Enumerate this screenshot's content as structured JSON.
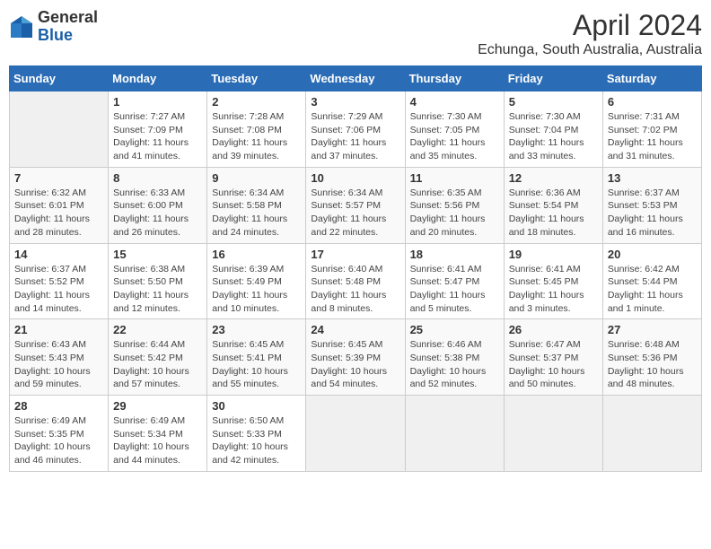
{
  "header": {
    "logo_general": "General",
    "logo_blue": "Blue",
    "title": "April 2024",
    "subtitle": "Echunga, South Australia, Australia"
  },
  "calendar": {
    "days_of_week": [
      "Sunday",
      "Monday",
      "Tuesday",
      "Wednesday",
      "Thursday",
      "Friday",
      "Saturday"
    ],
    "weeks": [
      [
        {
          "day": "",
          "info": ""
        },
        {
          "day": "1",
          "info": "Sunrise: 7:27 AM\nSunset: 7:09 PM\nDaylight: 11 hours\nand 41 minutes."
        },
        {
          "day": "2",
          "info": "Sunrise: 7:28 AM\nSunset: 7:08 PM\nDaylight: 11 hours\nand 39 minutes."
        },
        {
          "day": "3",
          "info": "Sunrise: 7:29 AM\nSunset: 7:06 PM\nDaylight: 11 hours\nand 37 minutes."
        },
        {
          "day": "4",
          "info": "Sunrise: 7:30 AM\nSunset: 7:05 PM\nDaylight: 11 hours\nand 35 minutes."
        },
        {
          "day": "5",
          "info": "Sunrise: 7:30 AM\nSunset: 7:04 PM\nDaylight: 11 hours\nand 33 minutes."
        },
        {
          "day": "6",
          "info": "Sunrise: 7:31 AM\nSunset: 7:02 PM\nDaylight: 11 hours\nand 31 minutes."
        }
      ],
      [
        {
          "day": "7",
          "info": "Sunrise: 6:32 AM\nSunset: 6:01 PM\nDaylight: 11 hours\nand 28 minutes."
        },
        {
          "day": "8",
          "info": "Sunrise: 6:33 AM\nSunset: 6:00 PM\nDaylight: 11 hours\nand 26 minutes."
        },
        {
          "day": "9",
          "info": "Sunrise: 6:34 AM\nSunset: 5:58 PM\nDaylight: 11 hours\nand 24 minutes."
        },
        {
          "day": "10",
          "info": "Sunrise: 6:34 AM\nSunset: 5:57 PM\nDaylight: 11 hours\nand 22 minutes."
        },
        {
          "day": "11",
          "info": "Sunrise: 6:35 AM\nSunset: 5:56 PM\nDaylight: 11 hours\nand 20 minutes."
        },
        {
          "day": "12",
          "info": "Sunrise: 6:36 AM\nSunset: 5:54 PM\nDaylight: 11 hours\nand 18 minutes."
        },
        {
          "day": "13",
          "info": "Sunrise: 6:37 AM\nSunset: 5:53 PM\nDaylight: 11 hours\nand 16 minutes."
        }
      ],
      [
        {
          "day": "14",
          "info": "Sunrise: 6:37 AM\nSunset: 5:52 PM\nDaylight: 11 hours\nand 14 minutes."
        },
        {
          "day": "15",
          "info": "Sunrise: 6:38 AM\nSunset: 5:50 PM\nDaylight: 11 hours\nand 12 minutes."
        },
        {
          "day": "16",
          "info": "Sunrise: 6:39 AM\nSunset: 5:49 PM\nDaylight: 11 hours\nand 10 minutes."
        },
        {
          "day": "17",
          "info": "Sunrise: 6:40 AM\nSunset: 5:48 PM\nDaylight: 11 hours\nand 8 minutes."
        },
        {
          "day": "18",
          "info": "Sunrise: 6:41 AM\nSunset: 5:47 PM\nDaylight: 11 hours\nand 5 minutes."
        },
        {
          "day": "19",
          "info": "Sunrise: 6:41 AM\nSunset: 5:45 PM\nDaylight: 11 hours\nand 3 minutes."
        },
        {
          "day": "20",
          "info": "Sunrise: 6:42 AM\nSunset: 5:44 PM\nDaylight: 11 hours\nand 1 minute."
        }
      ],
      [
        {
          "day": "21",
          "info": "Sunrise: 6:43 AM\nSunset: 5:43 PM\nDaylight: 10 hours\nand 59 minutes."
        },
        {
          "day": "22",
          "info": "Sunrise: 6:44 AM\nSunset: 5:42 PM\nDaylight: 10 hours\nand 57 minutes."
        },
        {
          "day": "23",
          "info": "Sunrise: 6:45 AM\nSunset: 5:41 PM\nDaylight: 10 hours\nand 55 minutes."
        },
        {
          "day": "24",
          "info": "Sunrise: 6:45 AM\nSunset: 5:39 PM\nDaylight: 10 hours\nand 54 minutes."
        },
        {
          "day": "25",
          "info": "Sunrise: 6:46 AM\nSunset: 5:38 PM\nDaylight: 10 hours\nand 52 minutes."
        },
        {
          "day": "26",
          "info": "Sunrise: 6:47 AM\nSunset: 5:37 PM\nDaylight: 10 hours\nand 50 minutes."
        },
        {
          "day": "27",
          "info": "Sunrise: 6:48 AM\nSunset: 5:36 PM\nDaylight: 10 hours\nand 48 minutes."
        }
      ],
      [
        {
          "day": "28",
          "info": "Sunrise: 6:49 AM\nSunset: 5:35 PM\nDaylight: 10 hours\nand 46 minutes."
        },
        {
          "day": "29",
          "info": "Sunrise: 6:49 AM\nSunset: 5:34 PM\nDaylight: 10 hours\nand 44 minutes."
        },
        {
          "day": "30",
          "info": "Sunrise: 6:50 AM\nSunset: 5:33 PM\nDaylight: 10 hours\nand 42 minutes."
        },
        {
          "day": "",
          "info": ""
        },
        {
          "day": "",
          "info": ""
        },
        {
          "day": "",
          "info": ""
        },
        {
          "day": "",
          "info": ""
        }
      ]
    ]
  }
}
